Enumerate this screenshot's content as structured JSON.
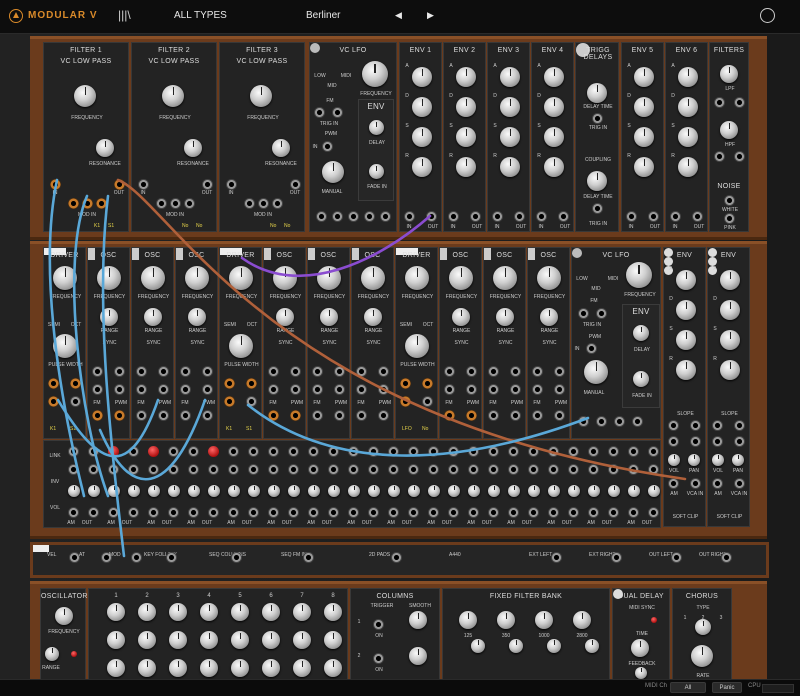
{
  "app": {
    "brand_a": "MODULAR",
    "brand_b": "V",
    "patch_category": "ALL TYPES",
    "preset_name": "Berliner"
  },
  "icons": {
    "logo": "arturia-logo-icon",
    "library": "library-icon",
    "prev": "triangle-left-icon",
    "next": "triangle-right-icon",
    "settings": "settings-face-icon"
  },
  "rack1": {
    "filters": [
      {
        "title": "FILTER 1",
        "sub": "VC LOW PASS",
        "freq": "FREQUENCY",
        "res": "RESONANCE",
        "in": "IN",
        "out": "OUT",
        "modin": "MOD IN",
        "k1": "K1",
        "k2": "S1"
      },
      {
        "title": "FILTER 2",
        "sub": "VC LOW PASS",
        "freq": "FREQUENCY",
        "res": "RESONANCE",
        "in": "IN",
        "out": "OUT",
        "modin": "MOD IN",
        "k1": "No",
        "k2": "No"
      },
      {
        "title": "FILTER 3",
        "sub": "VC LOW PASS",
        "freq": "FREQUENCY",
        "res": "RESONANCE",
        "in": "IN",
        "out": "OUT",
        "modin": "MOD IN",
        "k1": "No",
        "k2": "No"
      }
    ],
    "lfo": {
      "title": "VC LFO",
      "low": "LOW",
      "mid": "MID",
      "midi": "MIDI",
      "fm": "FM",
      "trig": "TRIG IN",
      "in": "IN",
      "pwm": "PWM",
      "manual": "MANUAL",
      "freq": "FREQUENCY",
      "env": "ENV",
      "delay": "DELAY",
      "fade": "FADE IN"
    },
    "envs": [
      {
        "title": "ENV 1"
      },
      {
        "title": "ENV 2"
      },
      {
        "title": "ENV 3"
      },
      {
        "title": "ENV 4"
      }
    ],
    "trigg": {
      "title": "TRIGG DELAYS",
      "delay": "DELAY TIME",
      "trig": "TRIG IN",
      "coupling": "COUPLING",
      "delay2": "DELAY TIME",
      "trig2": "TRIG IN"
    },
    "envs2": [
      {
        "title": "ENV 5"
      },
      {
        "title": "ENV 6"
      }
    ],
    "filters_util": {
      "title": "FILTERS",
      "lpf": "LPF",
      "hpf": "HPF",
      "noise": "NOISE",
      "white": "WHITE",
      "pink": "PINK"
    },
    "env_stage_labels": [
      "A",
      "D",
      "S",
      "R"
    ],
    "io_labels": [
      "IN",
      "OUT"
    ]
  },
  "rack2": {
    "modules": [
      {
        "title": "DRIVER",
        "freq": "FREQUENCY",
        "k1": "K1",
        "k2": "S1"
      },
      {
        "title": "OSC",
        "freq": "FREQUENCY",
        "range": "RANGE",
        "sync": "SYNC"
      },
      {
        "title": "OSC",
        "freq": "FREQUENCY",
        "range": "RANGE",
        "sync": "SYNC"
      },
      {
        "title": "OSC",
        "freq": "FREQUENCY",
        "range": "RANGE",
        "sync": "SYNC"
      },
      {
        "title": "DRIVER",
        "freq": "FREQUENCY",
        "k1": "K1",
        "k2": "S1"
      },
      {
        "title": "OSC",
        "freq": "FREQUENCY",
        "range": "RANGE",
        "sync": "SYNC"
      },
      {
        "title": "OSC",
        "freq": "FREQUENCY",
        "range": "RANGE",
        "sync": "SYNC"
      },
      {
        "title": "OSC",
        "freq": "FREQUENCY",
        "range": "RANGE",
        "sync": "SYNC"
      },
      {
        "title": "DRIVER",
        "freq": "FREQUENCY",
        "k1": "LFO",
        "k2": "No"
      },
      {
        "title": "OSC",
        "freq": "FREQUENCY",
        "range": "RANGE",
        "sync": "SYNC"
      },
      {
        "title": "OSC",
        "freq": "FREQUENCY",
        "range": "RANGE",
        "sync": "SYNC"
      },
      {
        "title": "OSC",
        "freq": "FREQUENCY",
        "range": "RANGE",
        "sync": "SYNC"
      }
    ],
    "semi": "SEMI",
    "oct": "OCT",
    "pulse_width": "PULSE WIDTH",
    "fm": "FM",
    "pwm": "PWM",
    "lfo": {
      "title": "VC LFO",
      "low": "LOW",
      "mid": "MID",
      "midi": "MIDI",
      "fm": "FM",
      "trig": "TRIG IN",
      "in": "IN",
      "pwm": "PWM",
      "manual": "MANUAL",
      "freq": "FREQUENCY",
      "env": "ENV",
      "delay": "DELAY",
      "fade": "FADE IN"
    },
    "envs": [
      {
        "title": "ENV",
        "slope": "SLOPE",
        "vol": "VOL",
        "pan": "PAN",
        "am": "AM",
        "vca": "VCA IN",
        "clip": "SOFT CLIP"
      },
      {
        "title": "ENV",
        "slope": "SLOPE",
        "vol": "VOL",
        "pan": "PAN",
        "am": "AM",
        "vca": "VCA IN",
        "clip": "SOFT CLIP"
      }
    ],
    "mixer_rows": [
      "LINK",
      "INV",
      "VOL"
    ],
    "mixer_out": [
      "AM",
      "OUT"
    ],
    "lin": "LIN"
  },
  "strip": {
    "items": [
      "VEL",
      "AT",
      "MOD",
      "KEY FOLLOW",
      "SEQ COLUMNS",
      "SEQ FM IN",
      "2D PADS",
      "A440",
      "EXT LEFT",
      "EXT RIGHT",
      "OUT LEFT",
      "OUT RIGHT"
    ]
  },
  "rack3": {
    "osc": {
      "title": "OSCILLATOR",
      "freq": "FREQUENCY",
      "range": "RANGE"
    },
    "seq_steps": [
      "1",
      "2",
      "3",
      "4",
      "5",
      "6",
      "7",
      "8"
    ],
    "columns": {
      "title": "COLUMNS",
      "trigger": "TRIGGER",
      "smooth": "SMOOTH",
      "on": "ON",
      "r1": "1",
      "r2": "2"
    },
    "ffb": {
      "title": "FIXED FILTER BANK",
      "bands": [
        "125",
        "350",
        "1000",
        "2800"
      ]
    },
    "delay": {
      "title": "DUAL DELAY",
      "sync": "MIDI SYNC",
      "time": "TIME",
      "feedback": "FEEDBACK"
    },
    "chorus": {
      "title": "CHORUS",
      "type": "TYPE",
      "rate": "RATE",
      "types": [
        "1",
        "2",
        "3"
      ]
    }
  },
  "status": {
    "midi_ch_label": "MIDI Ch",
    "midi_ch_value": "All",
    "panic": "Panic",
    "cpu": "CPU"
  },
  "cables": [
    {
      "color": "#8a4cd0"
    },
    {
      "color": "#b0603a"
    },
    {
      "color": "#5aa8d8"
    }
  ]
}
